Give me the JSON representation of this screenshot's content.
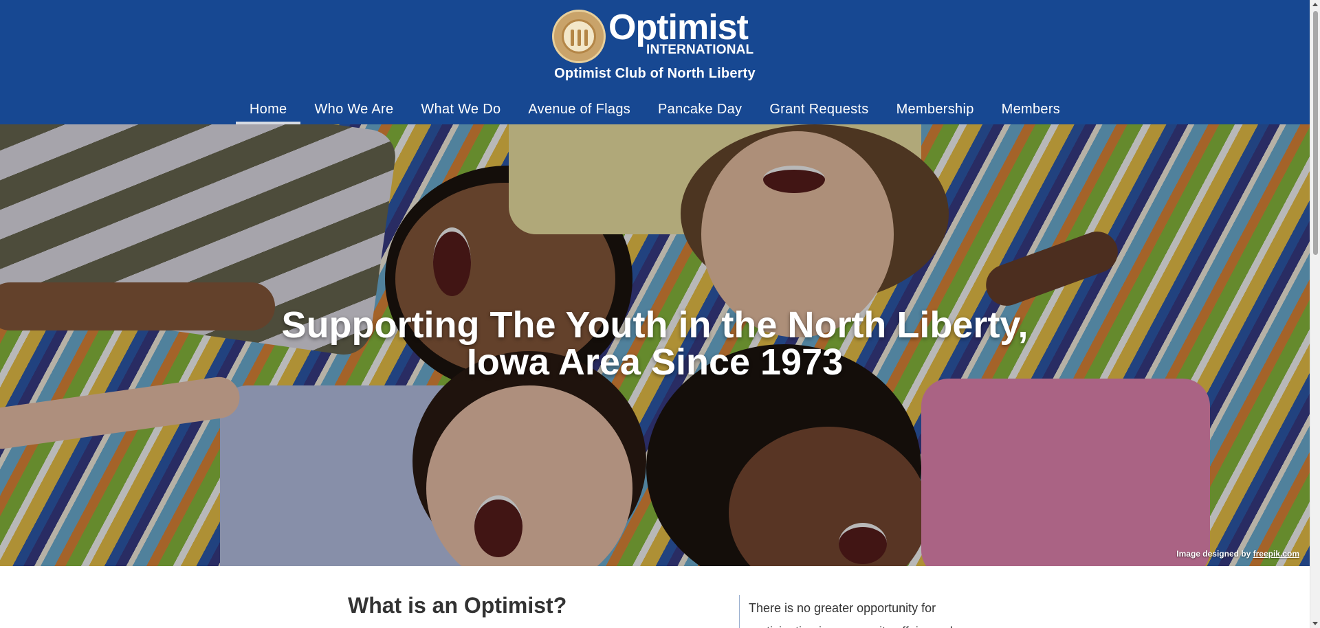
{
  "header": {
    "logo_text": "Optimist",
    "logo_subtext": "INTERNATIONAL",
    "club_name": "Optimist Club of North Liberty",
    "background_color": "#174892"
  },
  "nav": {
    "items": [
      {
        "label": "Home",
        "active": true
      },
      {
        "label": "Who We Are",
        "active": false
      },
      {
        "label": "What We Do",
        "active": false
      },
      {
        "label": "Avenue of Flags",
        "active": false
      },
      {
        "label": "Pancake Day",
        "active": false
      },
      {
        "label": "Grant Requests",
        "active": false
      },
      {
        "label": "Membership",
        "active": false
      },
      {
        "label": "Members",
        "active": false
      }
    ]
  },
  "hero": {
    "title_line1": "Supporting The Youth in the North Liberty,",
    "title_line2": "Iowa Area Since 1973",
    "credit_prefix": "Image designed by",
    "credit_link": "freepik.com",
    "image_description_icon": "children-lying-on-blanket-photo"
  },
  "content": {
    "section_title": "What is an Optimist?",
    "side_text": "There is no greater opportunity for participation in community affairs and"
  }
}
